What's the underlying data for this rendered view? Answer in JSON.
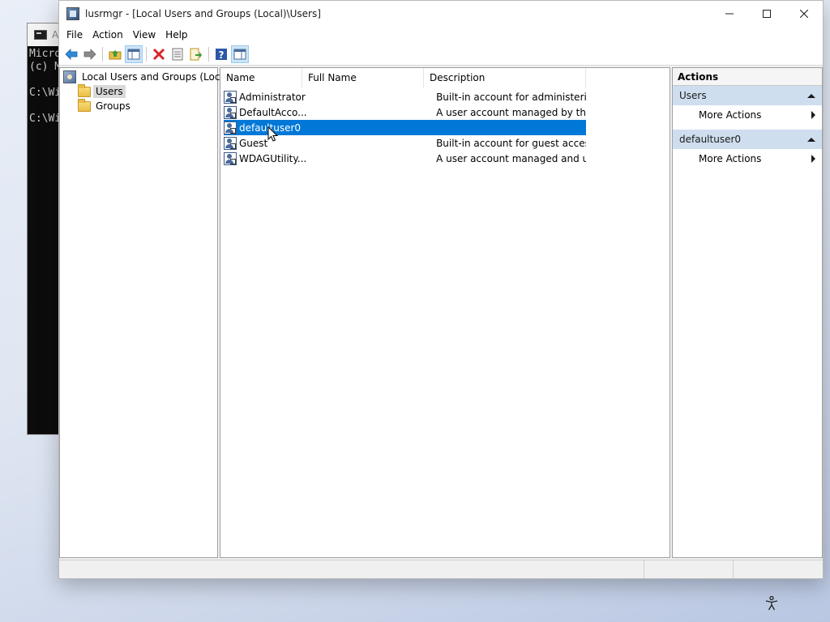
{
  "background_console": {
    "title_fragment": "A",
    "lines": [
      "Micro",
      "(c) M",
      "",
      "C:\\Wi",
      "",
      "C:\\Wi"
    ]
  },
  "window": {
    "title": "lusrmgr - [Local Users and Groups (Local)\\Users]",
    "controls": [
      "minimize",
      "maximize",
      "close"
    ]
  },
  "menu": [
    "File",
    "Action",
    "View",
    "Help"
  ],
  "toolbar": {
    "icons": [
      "back-arrow-icon",
      "forward-arrow-icon",
      "up-folder-icon",
      "show-hide-tree-icon",
      "delete-icon",
      "properties-icon",
      "export-list-icon",
      "help-icon",
      "show-hide-action-pane-icon"
    ]
  },
  "tree": {
    "root": "Local Users and Groups (Local)",
    "children": [
      "Users",
      "Groups"
    ],
    "selected": "Users"
  },
  "list": {
    "columns": [
      "Name",
      "Full Name",
      "Description"
    ],
    "rows": [
      {
        "name": "Administrator",
        "full_name": "",
        "description": "Built-in account for administering..."
      },
      {
        "name": "DefaultAcco...",
        "full_name": "",
        "description": "A user account managed by the s..."
      },
      {
        "name": "defaultuser0",
        "full_name": "",
        "description": ""
      },
      {
        "name": "Guest",
        "full_name": "",
        "description": "Built-in account for guest access t..."
      },
      {
        "name": "WDAGUtility...",
        "full_name": "",
        "description": "A user account managed and use..."
      }
    ],
    "selected_index": 2
  },
  "actions": {
    "header": "Actions",
    "sections": [
      {
        "title": "Users",
        "items": [
          "More Actions"
        ]
      },
      {
        "title": "defaultuser0",
        "items": [
          "More Actions"
        ]
      }
    ]
  },
  "colors": {
    "selection": "#0078d7",
    "action_section": "#cfdeef",
    "delete_red": "#d8262b"
  }
}
